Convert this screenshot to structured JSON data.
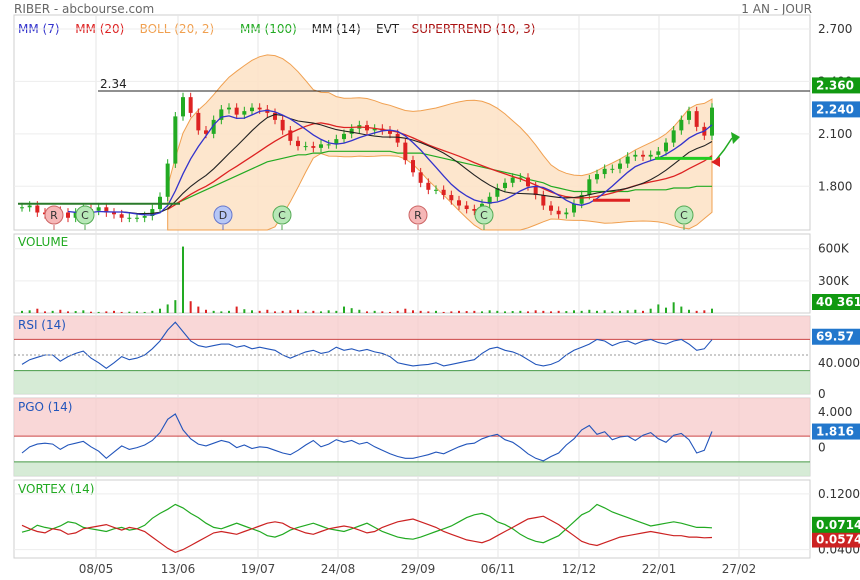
{
  "header": {
    "title": "RIBER - abcbourse.com",
    "period": "1 AN - JOUR"
  },
  "legend": [
    {
      "label": "MM (7)",
      "color": "#3333cc"
    },
    {
      "label": "MM (20)",
      "color": "#dd2222"
    },
    {
      "label": "BOLL (20, 2)",
      "color": "#f0a050"
    },
    {
      "label": "MM (100)",
      "color": "#22aa22"
    },
    {
      "label": "MM (14)",
      "color": "#222222"
    },
    {
      "label": "EVT",
      "color": "#222222"
    },
    {
      "label": "SUPERTREND (10, 3)",
      "color": "#aa1111"
    }
  ],
  "x_labels": [
    "08/05",
    "13/06",
    "19/07",
    "24/08",
    "29/09",
    "06/11",
    "12/12",
    "22/01",
    "27/02"
  ],
  "chart_data": [
    {
      "type": "line",
      "name": "price",
      "ylim": [
        1.55,
        2.78
      ],
      "ticks": [
        "2.700",
        "2.400",
        "2.100",
        "1.800"
      ],
      "hline": {
        "label": "2.34",
        "value": 2.345
      },
      "badges": [
        {
          "label": "2.360",
          "color": "#119911"
        },
        {
          "label": "2.240",
          "color": "#2277cc"
        }
      ],
      "events": [
        "R",
        "C",
        "D",
        "C",
        "R",
        "C",
        "C"
      ],
      "price": [
        1.68,
        1.69,
        1.65,
        1.64,
        1.66,
        1.65,
        1.62,
        1.65,
        1.67,
        1.66,
        1.68,
        1.65,
        1.64,
        1.62,
        1.62,
        1.62,
        1.63,
        1.67,
        1.74,
        1.93,
        2.2,
        2.31,
        2.22,
        2.12,
        2.1,
        2.18,
        2.24,
        2.25,
        2.21,
        2.23,
        2.25,
        2.24,
        2.22,
        2.18,
        2.12,
        2.06,
        2.03,
        2.03,
        2.02,
        2.04,
        2.04,
        2.07,
        2.1,
        2.13,
        2.15,
        2.12,
        2.13,
        2.12,
        2.1,
        2.05,
        1.95,
        1.88,
        1.82,
        1.78,
        1.78,
        1.75,
        1.72,
        1.69,
        1.67,
        1.66,
        1.7,
        1.74,
        1.79,
        1.82,
        1.85,
        1.85,
        1.8,
        1.75,
        1.69,
        1.66,
        1.64,
        1.65,
        1.7,
        1.75,
        1.84,
        1.87,
        1.9,
        1.9,
        1.93,
        1.97,
        1.98,
        1.97,
        1.98,
        2.0,
        2.05,
        2.12,
        2.18,
        2.23,
        2.14,
        2.09,
        2.25
      ],
      "mm100": [
        null,
        null,
        null,
        null,
        null,
        null,
        null,
        null,
        null,
        null,
        null,
        null,
        null,
        null,
        null,
        null,
        null,
        null,
        null,
        null,
        1.7,
        1.72,
        1.74,
        1.76,
        1.78,
        1.8,
        1.82,
        1.84,
        1.86,
        1.88,
        1.9,
        1.92,
        1.94,
        1.95,
        1.96,
        1.97,
        1.98,
        1.98,
        1.99,
        1.99,
        2.0,
        2.0,
        2.0,
        2.0,
        2.0,
        2.0,
        2.0,
        2.0,
        2.0,
        1.99,
        1.99,
        1.99,
        1.99,
        1.98,
        1.97,
        1.96,
        1.95,
        1.94,
        1.93,
        1.92,
        1.91,
        1.9,
        1.89,
        1.88,
        1.87,
        1.86,
        1.84,
        1.83,
        1.82,
        1.8,
        1.79,
        1.78,
        1.77,
        1.77,
        1.77,
        1.77,
        1.77,
        1.77,
        1.77,
        1.77,
        1.78,
        1.78,
        1.78,
        1.78,
        1.78,
        1.79,
        1.79,
        1.79,
        1.8,
        1.8,
        1.8
      ]
    },
    {
      "type": "bar",
      "name": "VOLUME",
      "ylim": [
        0,
        700000
      ],
      "ticks": [
        "600K",
        "300K"
      ],
      "badge": {
        "label": "40 361",
        "color": "#119911"
      },
      "values": [
        20000,
        25000,
        40000,
        15000,
        20000,
        30000,
        15000,
        18000,
        25000,
        12000,
        10000,
        15000,
        20000,
        10000,
        12000,
        15000,
        10000,
        20000,
        40000,
        80000,
        120000,
        620000,
        110000,
        60000,
        30000,
        20000,
        15000,
        20000,
        60000,
        35000,
        25000,
        20000,
        30000,
        15000,
        20000,
        25000,
        30000,
        15000,
        20000,
        15000,
        25000,
        20000,
        60000,
        45000,
        30000,
        15000,
        20000,
        15000,
        10000,
        20000,
        40000,
        25000,
        20000,
        15000,
        20000,
        10000,
        15000,
        20000,
        18000,
        20000,
        15000,
        25000,
        20000,
        15000,
        18000,
        20000,
        15000,
        25000,
        20000,
        15000,
        20000,
        18000,
        25000,
        20000,
        30000,
        20000,
        25000,
        15000,
        20000,
        25000,
        30000,
        20000,
        40000,
        80000,
        50000,
        100000,
        60000,
        30000,
        20000,
        25000,
        40361
      ]
    },
    {
      "type": "line",
      "name": "RSI (14)",
      "ylim": [
        0,
        100
      ],
      "ticks": [
        "40.000",
        "0"
      ],
      "badge": {
        "label": "69.57",
        "color": "#2277cc"
      },
      "upper": 70,
      "lower": 30,
      "values": [
        38,
        44,
        47,
        50,
        50,
        42,
        48,
        52,
        55,
        46,
        40,
        33,
        40,
        48,
        44,
        46,
        50,
        58,
        68,
        82,
        92,
        80,
        68,
        62,
        60,
        62,
        64,
        64,
        60,
        62,
        58,
        60,
        58,
        56,
        50,
        46,
        50,
        54,
        56,
        52,
        54,
        60,
        56,
        58,
        55,
        57,
        54,
        52,
        48,
        40,
        38,
        36,
        37,
        38,
        40,
        36,
        38,
        40,
        42,
        44,
        52,
        58,
        60,
        56,
        54,
        50,
        44,
        38,
        36,
        38,
        42,
        50,
        56,
        60,
        64,
        70,
        68,
        62,
        66,
        68,
        64,
        68,
        70,
        66,
        64,
        68,
        70,
        64,
        56,
        58,
        69.57
      ]
    },
    {
      "type": "line",
      "name": "PGO (14)",
      "ylim": [
        -3.2,
        5.6
      ],
      "ticks": [
        "4.000",
        "0"
      ],
      "badge": {
        "label": "1.816",
        "color": "#2277cc"
      },
      "upper": 1.3,
      "lower": -1.6,
      "values": [
        -0.6,
        0.1,
        0.4,
        0.5,
        0.4,
        -0.2,
        0.3,
        0.5,
        0.7,
        0.1,
        -0.4,
        -1.2,
        -0.5,
        0.2,
        -0.2,
        0.0,
        0.3,
        0.8,
        1.7,
        3.2,
        3.8,
        2.0,
        1.0,
        0.4,
        0.2,
        0.5,
        0.8,
        0.6,
        0.0,
        0.3,
        -0.1,
        0.1,
        0.0,
        -0.3,
        -0.6,
        -0.8,
        -0.3,
        0.3,
        0.8,
        0.1,
        0.4,
        0.9,
        0.6,
        0.8,
        0.4,
        0.6,
        0.1,
        -0.3,
        -0.7,
        -1.0,
        -1.2,
        -1.2,
        -1.0,
        -0.8,
        -0.5,
        -0.7,
        -0.3,
        0.1,
        0.4,
        0.5,
        1.0,
        1.3,
        1.5,
        0.9,
        0.6,
        0.0,
        -0.7,
        -1.2,
        -1.5,
        -1.0,
        -0.6,
        0.3,
        1.0,
        2.0,
        2.5,
        1.5,
        1.8,
        0.9,
        1.2,
        1.3,
        0.8,
        1.4,
        1.7,
        1.0,
        0.6,
        1.4,
        1.6,
        0.9,
        -0.6,
        -0.3,
        1.816
      ]
    },
    {
      "type": "line",
      "name": "VORTEX (14)",
      "ylim": [
        0.028,
        0.14
      ],
      "ticks": [
        "0.1200",
        "0.0400"
      ],
      "badges": [
        {
          "label": "0.0714",
          "color": "#119911"
        },
        {
          "label": "0.0574",
          "color": "#cc2222"
        }
      ],
      "series": [
        {
          "name": "VI+",
          "color": "#22aa22",
          "values": [
            0.065,
            0.068,
            0.075,
            0.072,
            0.07,
            0.074,
            0.08,
            0.078,
            0.072,
            0.07,
            0.068,
            0.066,
            0.07,
            0.072,
            0.068,
            0.07,
            0.075,
            0.085,
            0.092,
            0.098,
            0.105,
            0.1,
            0.092,
            0.086,
            0.078,
            0.072,
            0.07,
            0.074,
            0.078,
            0.074,
            0.07,
            0.066,
            0.06,
            0.058,
            0.062,
            0.068,
            0.072,
            0.075,
            0.078,
            0.074,
            0.07,
            0.068,
            0.066,
            0.07,
            0.074,
            0.078,
            0.072,
            0.066,
            0.062,
            0.058,
            0.056,
            0.055,
            0.058,
            0.062,
            0.066,
            0.07,
            0.074,
            0.08,
            0.086,
            0.09,
            0.092,
            0.088,
            0.08,
            0.076,
            0.07,
            0.062,
            0.056,
            0.052,
            0.05,
            0.055,
            0.06,
            0.07,
            0.08,
            0.09,
            0.095,
            0.105,
            0.1,
            0.094,
            0.09,
            0.086,
            0.082,
            0.078,
            0.074,
            0.076,
            0.078,
            0.08,
            0.078,
            0.075,
            0.072,
            0.072,
            0.0714
          ]
        },
        {
          "name": "VI-",
          "color": "#cc2222",
          "values": [
            0.075,
            0.07,
            0.066,
            0.064,
            0.07,
            0.068,
            0.062,
            0.064,
            0.07,
            0.072,
            0.074,
            0.076,
            0.072,
            0.068,
            0.072,
            0.07,
            0.066,
            0.058,
            0.05,
            0.042,
            0.036,
            0.04,
            0.046,
            0.052,
            0.058,
            0.064,
            0.066,
            0.064,
            0.062,
            0.066,
            0.07,
            0.074,
            0.078,
            0.08,
            0.078,
            0.072,
            0.068,
            0.064,
            0.062,
            0.066,
            0.07,
            0.072,
            0.074,
            0.072,
            0.068,
            0.064,
            0.066,
            0.072,
            0.076,
            0.08,
            0.082,
            0.084,
            0.08,
            0.076,
            0.072,
            0.066,
            0.062,
            0.058,
            0.054,
            0.052,
            0.05,
            0.054,
            0.06,
            0.066,
            0.072,
            0.078,
            0.084,
            0.086,
            0.088,
            0.082,
            0.076,
            0.068,
            0.06,
            0.052,
            0.048,
            0.046,
            0.05,
            0.054,
            0.058,
            0.06,
            0.062,
            0.064,
            0.066,
            0.064,
            0.062,
            0.06,
            0.06,
            0.058,
            0.058,
            0.057,
            0.0574
          ]
        }
      ]
    }
  ]
}
